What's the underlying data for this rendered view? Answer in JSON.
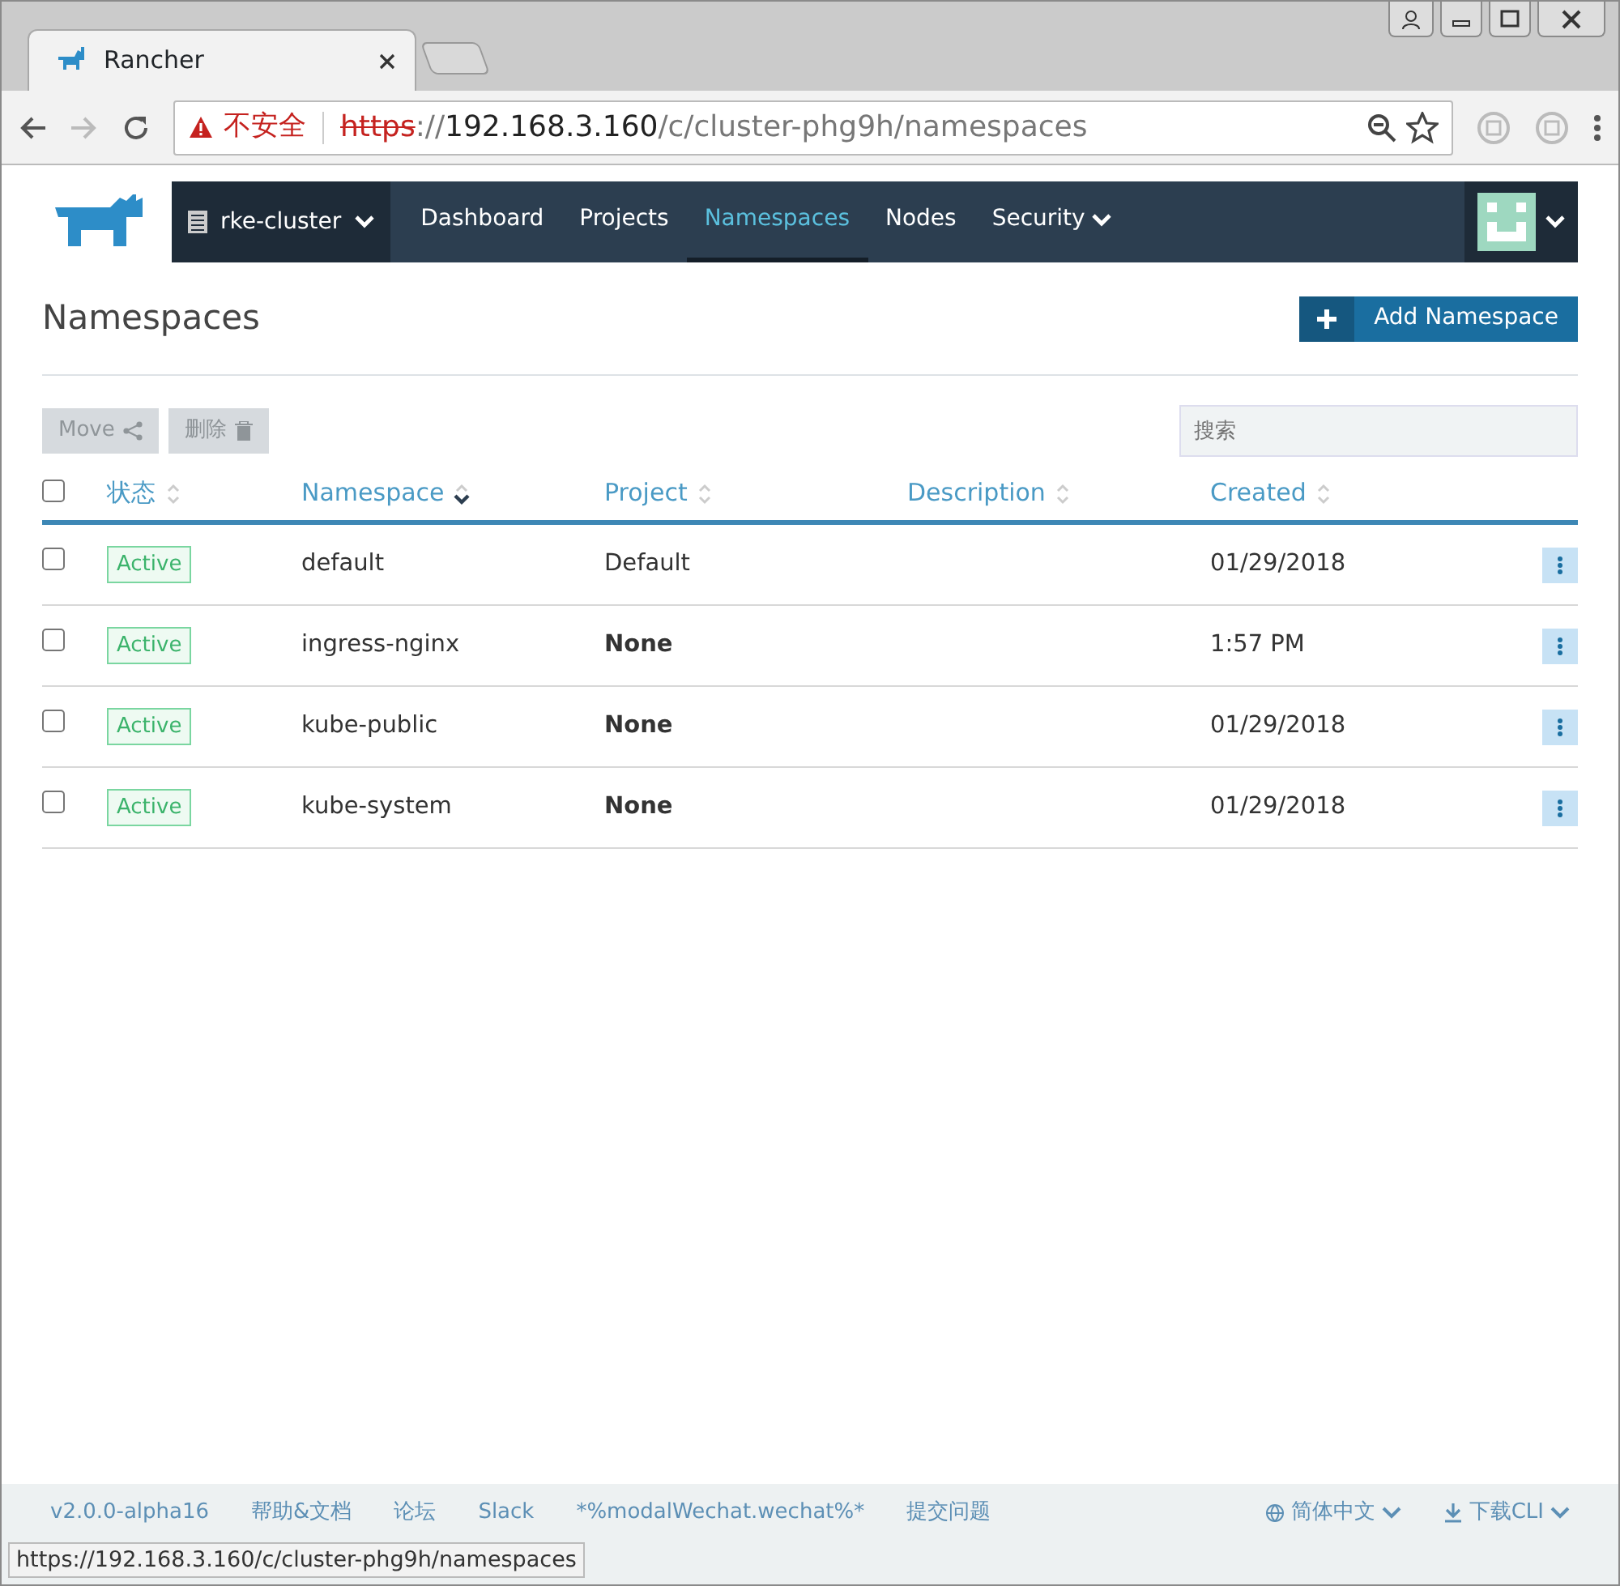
{
  "browser": {
    "tab_title": "Rancher",
    "address": {
      "security_label": "不安全",
      "scheme": "https",
      "scheme_separator": "://",
      "host": "192.168.3.160",
      "path": "/c/cluster-phg9h/namespaces"
    }
  },
  "nav": {
    "cluster": "rke-cluster",
    "items": [
      {
        "label": "Dashboard",
        "selected": false,
        "dropdown": false
      },
      {
        "label": "Projects",
        "selected": false,
        "dropdown": false
      },
      {
        "label": "Namespaces",
        "selected": true,
        "dropdown": false
      },
      {
        "label": "Nodes",
        "selected": false,
        "dropdown": false
      },
      {
        "label": "Security",
        "selected": false,
        "dropdown": true
      }
    ]
  },
  "page": {
    "title": "Namespaces",
    "add_button": "Add Namespace"
  },
  "toolbar": {
    "buttons": [
      {
        "label": "Move",
        "kind": "move",
        "disabled": true
      },
      {
        "label": "删除",
        "kind": "delete",
        "disabled": true
      }
    ],
    "search": {
      "placeholder": "搜索"
    }
  },
  "table": {
    "all_checked": false,
    "columns": [
      {
        "label": "状态",
        "sorted": false
      },
      {
        "label": "Namespace",
        "sorted": true
      },
      {
        "label": "Project",
        "sorted": false
      },
      {
        "label": "Description",
        "sorted": false
      },
      {
        "label": "Created",
        "sorted": false
      }
    ],
    "rows": [
      {
        "checked": false,
        "state": "Active",
        "namespace": "default",
        "project": "Default",
        "assigned": true,
        "created": "01/29/2018"
      },
      {
        "checked": false,
        "state": "Active",
        "namespace": "ingress-nginx",
        "project": "None",
        "assigned": false,
        "created": "1:57 PM"
      },
      {
        "checked": false,
        "state": "Active",
        "namespace": "kube-public",
        "project": "None",
        "assigned": false,
        "created": "01/29/2018"
      },
      {
        "checked": false,
        "state": "Active",
        "namespace": "kube-system",
        "project": "None",
        "assigned": false,
        "created": "01/29/2018"
      }
    ]
  },
  "footer": {
    "links": [
      "v2.0.0-alpha16",
      "帮助&文档",
      "论坛",
      "Slack",
      "*%modalWechat.wechat%*",
      "提交问题"
    ],
    "language": "简体中文",
    "download": "下载CLI"
  },
  "status_url": "https://192.168.3.160/c/cluster-phg9h/namespaces"
}
